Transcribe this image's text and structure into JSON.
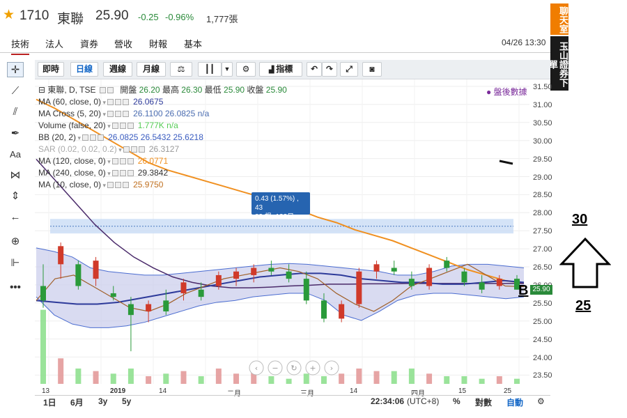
{
  "header": {
    "code": "1710",
    "name": "東聯",
    "price": "25.90",
    "change": "-0.25",
    "pct": "-0.96%",
    "volume": "1,777張",
    "datetime": "04/26 13:30"
  },
  "tabs": [
    "技術",
    "法人",
    "資券",
    "營收",
    "財報",
    "基本"
  ],
  "badges": {
    "chat": "聊天室",
    "broker": "玉山證券下單"
  },
  "toolbar": {
    "realtime": "即時",
    "daily": "日線",
    "weekly": "週線",
    "monthly": "月線",
    "indicators": "指標"
  },
  "legend": {
    "main": {
      "label": "東聯, D, TSE",
      "open_l": "開盤",
      "open": "26.20",
      "high_l": "最高",
      "high": "26.30",
      "low_l": "最低",
      "low": "25.90",
      "close_l": "收盤",
      "close": "25.90"
    },
    "rows": [
      {
        "label": "MA (60, close, 0)",
        "value": "26.0675",
        "color": "#2d3a9a"
      },
      {
        "label": "MA Cross (5, 20)",
        "value": "26.1100  26.0825  n/a",
        "color": "#4a6cb0"
      },
      {
        "label": "Volume (false, 20)",
        "value": "1.777K  n/a",
        "color": "#55cc55"
      },
      {
        "label": "BB (20, 2)",
        "value": "26.0825  26.5432  25.6218",
        "color": "#3a5cc0"
      },
      {
        "label": "SAR (0.02, 0.02, 0.2)",
        "value": "26.3127",
        "color": "#999999"
      },
      {
        "label": "MA (120, close, 0)",
        "value": "26.0771",
        "color": "#f09020"
      },
      {
        "label": "MA (240, close, 0)",
        "value": "29.3842",
        "color": "#333333"
      },
      {
        "label": "MA (10, close, 0)",
        "value": "25.9750",
        "color": "#c07020"
      }
    ]
  },
  "after_hours": "● 盤後數據",
  "tooltip": {
    "line1": "0.43 (1.57%) , 43",
    "line2": "83 根, 133日"
  },
  "price_box": "25.90",
  "y_ticks": [
    "31.50",
    "31.00",
    "30.50",
    "30.00",
    "29.50",
    "29.00",
    "28.50",
    "28.00",
    "27.50",
    "27.00",
    "26.50",
    "26.00",
    "25.50",
    "25.00",
    "24.50",
    "24.00",
    "23.50"
  ],
  "x_ticks": [
    "13",
    "2019",
    "14",
    "二月",
    "三月",
    "14",
    "四月",
    "15",
    "25"
  ],
  "bottom": {
    "ranges": [
      "1日",
      "6月",
      "3y",
      "5y"
    ],
    "time": "22:34:06",
    "tz": "(UTC+8)",
    "pct": "%",
    "log": "對數",
    "auto": "自動"
  },
  "annotations": {
    "a30": "30",
    "a25": "25",
    "b": "B"
  },
  "colors": {
    "up": "#d03a2a",
    "down": "#2a9a3a",
    "bb_fill": "#c5c8ea",
    "ma120": "#f09020",
    "ma240": "#4a2a6a",
    "ma60": "#2d3a9a"
  },
  "chart_data": {
    "type": "candlestick",
    "y_range": [
      23.3,
      31.7
    ],
    "bollinger_band_upper": [
      27.05,
      26.95,
      26.8,
      26.5,
      26.4,
      26.35,
      26.3,
      26.3,
      26.35,
      26.4,
      26.45,
      26.5,
      26.55,
      26.6,
      26.62,
      26.6,
      26.55,
      26.5,
      26.45,
      26.4,
      26.3,
      26.3,
      26.4,
      26.55,
      26.6,
      26.6,
      26.55,
      26.5
    ],
    "bollinger_band_lower": [
      25.7,
      25.2,
      24.95,
      24.85,
      24.85,
      24.9,
      25.0,
      25.15,
      25.3,
      25.45,
      25.55,
      25.6,
      25.7,
      25.75,
      25.8,
      25.8,
      25.6,
      25.2,
      25.05,
      25.3,
      25.6,
      25.75,
      25.8,
      25.8,
      25.75,
      25.7,
      25.65,
      25.7
    ],
    "ma120": [
      31.15,
      30.9,
      30.6,
      30.3,
      30.0,
      29.7,
      29.4,
      29.2,
      29.05,
      28.9,
      28.75,
      28.6,
      28.45,
      28.3,
      28.1,
      27.9,
      27.75,
      27.55,
      27.4,
      27.25,
      27.05,
      26.85,
      26.65,
      26.45,
      26.3,
      26.15,
      26.08
    ],
    "ma240": [
      29.5,
      28.9,
      28.3,
      27.7,
      27.2,
      26.8,
      26.5,
      26.25,
      26.1,
      26.0,
      25.95,
      25.95,
      25.97,
      26.0,
      26.02,
      26.05,
      26.05,
      26.06,
      26.06,
      26.07,
      26.07,
      26.07,
      26.07,
      26.07,
      26.07,
      26.07
    ],
    "ma60": [
      25.6,
      25.55,
      25.5,
      25.5,
      25.55,
      25.65,
      25.75,
      25.85,
      25.95,
      26.05,
      26.15,
      26.25,
      26.3,
      26.35,
      26.35,
      26.3,
      26.2,
      26.15,
      26.1,
      26.1,
      26.05,
      26.05,
      26.1,
      26.15,
      26.1
    ],
    "ma10": [
      25.6,
      26.2,
      26.3,
      26.0,
      25.7,
      25.4,
      25.3,
      25.5,
      25.8,
      26.0,
      26.2,
      26.3,
      26.4,
      26.5,
      26.4,
      26.2,
      25.8,
      25.5,
      25.3,
      25.6,
      26.0,
      26.2,
      26.4,
      26.6,
      26.3,
      26.0,
      25.98
    ],
    "candles": [
      [
        26.0,
        26.6,
        25.4,
        25.6
      ],
      [
        26.6,
        27.2,
        26.2,
        27.1
      ],
      [
        26.6,
        26.7,
        25.9,
        26.0
      ],
      [
        26.2,
        26.8,
        26.0,
        26.7
      ],
      [
        25.8,
        26.0,
        25.6,
        25.7
      ],
      [
        25.5,
        25.7,
        24.2,
        25.2
      ],
      [
        25.3,
        25.6,
        25.0,
        25.5
      ],
      [
        25.6,
        25.9,
        25.2,
        25.3
      ],
      [
        25.8,
        26.2,
        25.6,
        26.1
      ],
      [
        25.9,
        26.1,
        25.6,
        25.7
      ],
      [
        26.0,
        26.4,
        25.9,
        26.3
      ],
      [
        26.2,
        26.5,
        26.0,
        26.4
      ],
      [
        26.3,
        26.6,
        26.1,
        26.5
      ],
      [
        26.5,
        26.7,
        26.3,
        26.4
      ],
      [
        26.4,
        26.6,
        26.1,
        26.2
      ],
      [
        26.2,
        26.4,
        25.5,
        25.6
      ],
      [
        25.6,
        25.8,
        25.0,
        25.1
      ],
      [
        25.1,
        25.6,
        25.0,
        25.5
      ],
      [
        25.5,
        26.5,
        25.4,
        26.4
      ],
      [
        26.4,
        26.7,
        26.2,
        26.6
      ],
      [
        26.5,
        26.7,
        26.3,
        26.4
      ],
      [
        26.2,
        26.4,
        25.9,
        26.0
      ],
      [
        26.0,
        26.6,
        25.9,
        26.5
      ],
      [
        26.7,
        26.8,
        26.4,
        26.5
      ],
      [
        26.4,
        26.5,
        26.0,
        26.1
      ],
      [
        26.1,
        26.3,
        25.8,
        25.9
      ],
      [
        26.0,
        26.3,
        25.9,
        26.2
      ],
      [
        26.2,
        26.3,
        25.9,
        25.9
      ]
    ],
    "volume": [
      29,
      10,
      6,
      5,
      4,
      6,
      3,
      4,
      5,
      3,
      6,
      4,
      5,
      3,
      2,
      4,
      3,
      4,
      6,
      5,
      5,
      6,
      4,
      3,
      3,
      2,
      3,
      2
    ]
  }
}
